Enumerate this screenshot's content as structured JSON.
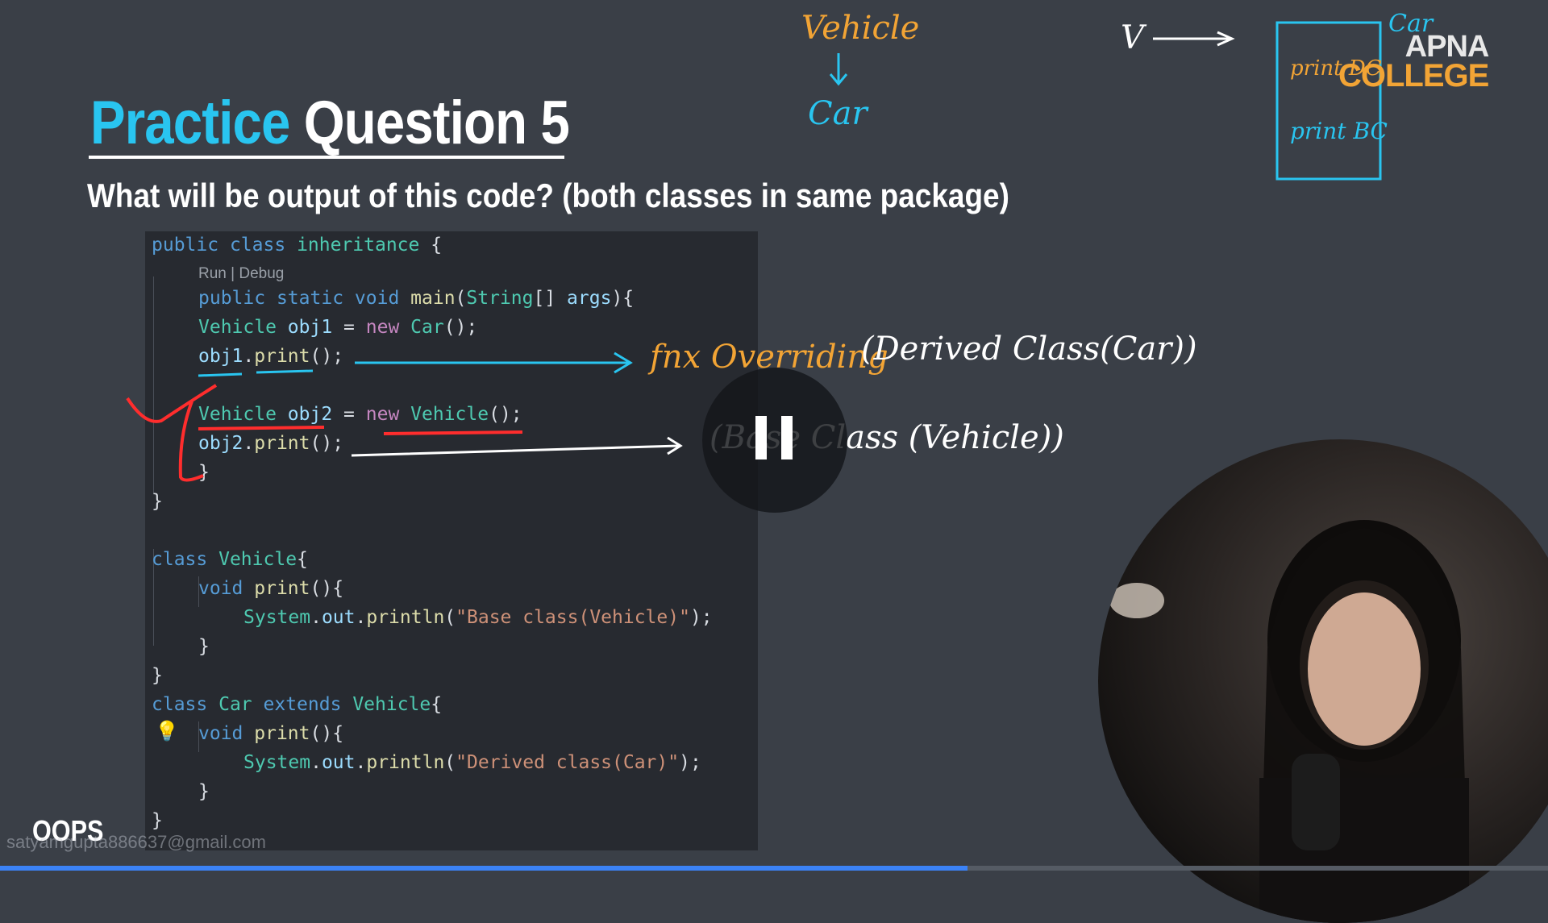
{
  "slide": {
    "title_accent": "Practice",
    "title_rest": "Question 5",
    "subtitle": "What will be output of this code? (both classes in same package)",
    "footer_label": "OOPS",
    "watermark": "satyamgupta886637@gmail.com"
  },
  "logo": {
    "line1": "APNA",
    "line2": "COLLEGE"
  },
  "code": {
    "codelens": "Run | Debug",
    "lines": {
      "l1": [
        "public",
        "class",
        "inheritance",
        "{"
      ],
      "l3": [
        "public",
        "static",
        "void",
        "main",
        "(",
        "String",
        "[] ",
        "args",
        "){"
      ],
      "l4": [
        "Vehicle",
        "obj1",
        "=",
        "new",
        "Car",
        "();"
      ],
      "l5": [
        "obj1",
        ".",
        "print",
        "();"
      ],
      "l7": [
        "Vehicle",
        "obj2",
        "=",
        "new",
        "Vehicle",
        "();"
      ],
      "l8": [
        "obj2",
        ".",
        "print",
        "();"
      ],
      "l9": "}",
      "l10": "}",
      "l12": [
        "class",
        "Vehicle",
        "{"
      ],
      "l13": [
        "void",
        "print",
        "(){"
      ],
      "l14": [
        "System",
        ".",
        "out",
        ".",
        "println",
        "(",
        "\"Base class(Vehicle)\"",
        ");"
      ],
      "l15": "}",
      "l16": "}",
      "l17": [
        "class",
        "Car",
        "extends",
        "Vehicle",
        "{"
      ],
      "l18": [
        "void",
        "print",
        "(){"
      ],
      "l19": [
        "System",
        ".",
        "out",
        ".",
        "println",
        "(",
        "\"Derived class(Car)\"",
        ");"
      ],
      "l20": "}",
      "l21": "}"
    }
  },
  "annotations": {
    "vehicle": "Vehicle",
    "car_top": "Car",
    "v_arrow": "V",
    "box_car": "Car",
    "box_print_dc": "print DC",
    "box_print_bc": "print BC",
    "overriding": "fnx Overriding",
    "derived_class": "(Derived Class(Car))",
    "base_class": "(Base Class (Vehicle))"
  },
  "player": {
    "progress_percent": 62.5
  },
  "colors": {
    "background": "#3a3f47",
    "accent_blue": "#29c5f0",
    "ink_orange": "#f2a435",
    "ink_red": "#ff2d2d",
    "code_bg": "#272a30"
  },
  "icons": {
    "pause": "pause-icon",
    "hint": "lightbulb-icon"
  }
}
